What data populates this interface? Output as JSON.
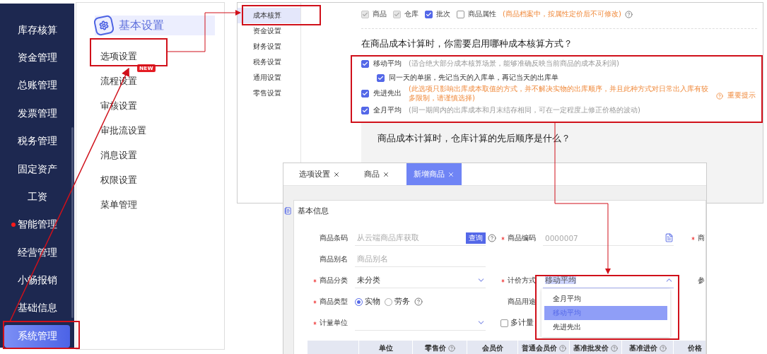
{
  "sidebar": {
    "items": [
      {
        "label": "库存核算",
        "selected": false,
        "alert": false
      },
      {
        "label": "资金管理",
        "selected": false,
        "alert": false
      },
      {
        "label": "总账管理",
        "selected": false,
        "alert": false
      },
      {
        "label": "发票管理",
        "selected": false,
        "alert": false
      },
      {
        "label": "税务管理",
        "selected": false,
        "alert": false
      },
      {
        "label": "固定资产",
        "selected": false,
        "alert": false
      },
      {
        "label": "工资",
        "selected": false,
        "alert": false
      },
      {
        "label": "智能管理",
        "selected": false,
        "alert": true
      },
      {
        "label": "经营管理",
        "selected": false,
        "alert": false
      },
      {
        "label": "小畅报销",
        "selected": false,
        "alert": false
      },
      {
        "label": "基础信息",
        "selected": false,
        "alert": false
      },
      {
        "label": "系统管理",
        "selected": true,
        "alert": false
      }
    ]
  },
  "settings_menu": {
    "title": "基本设置",
    "items": [
      {
        "label": "选项设置"
      },
      {
        "label": "流程设置",
        "badge": "NEW"
      },
      {
        "label": "审核设置"
      },
      {
        "label": "审批流设置"
      },
      {
        "label": "消息设置"
      },
      {
        "label": "权限设置"
      },
      {
        "label": "菜单管理"
      }
    ]
  },
  "cost_settings": {
    "menu": [
      {
        "label": "成本核算",
        "selected": true
      },
      {
        "label": "资金设置",
        "selected": false
      },
      {
        "label": "财务设置",
        "selected": false
      },
      {
        "label": "税务设置",
        "selected": false
      },
      {
        "label": "通用设置",
        "selected": false
      },
      {
        "label": "零售设置",
        "selected": false
      }
    ],
    "factors": [
      {
        "label": "商品",
        "checked": true,
        "disabled": true
      },
      {
        "label": "仓库",
        "checked": true,
        "disabled": true
      },
      {
        "label": "批次",
        "checked": true,
        "disabled": false
      },
      {
        "label": "商品属性",
        "checked": false,
        "disabled": false
      }
    ],
    "factors_note": "(商品档案中，按属性定价后不可修改)",
    "question": "在商品成本计算时，你需要启用哪种成本核算方式？",
    "methods": [
      {
        "label": "移动平均",
        "checked": true,
        "warning": false,
        "note": "(适合绝大部分成本核算场景，能够准确反映当前商品的成本及利润)",
        "children": [
          {
            "label": "同一天的单据，先记当天的入库单，再记当天的出库单",
            "checked": true
          }
        ]
      },
      {
        "label": "先进先出",
        "checked": true,
        "warning": true,
        "note": "(此选项只影响出库成本取值的方式，并不解决实物的出库顺序，并且此种方式对日常出入库有较多限制，请谨慎选择)",
        "link": "重要提示"
      },
      {
        "label": "全月平均",
        "checked": true,
        "warning": false,
        "note": "(同一期间内的出库成本和月末结存相同，可在一定程度上修正价格的波动)"
      }
    ],
    "next_question": "商品成本计算时，仓库计算的先后顺序是什么？"
  },
  "product_form": {
    "tabs": [
      {
        "label": "选项设置",
        "selected": false
      },
      {
        "label": "商品",
        "selected": false
      },
      {
        "label": "新增商品",
        "selected": true
      }
    ],
    "section_title": "基本信息",
    "rows": [
      [
        {
          "kind": "text",
          "label": "商品条码",
          "required": false,
          "placeholder": "从云端商品库获取",
          "button": "查询",
          "help": true
        },
        {
          "kind": "code",
          "label": "商品编码",
          "required": true,
          "placeholder": "0000007"
        },
        {
          "kind": "cut",
          "label": "商",
          "required": true
        }
      ],
      [
        {
          "kind": "text",
          "label": "商品别名",
          "required": false,
          "placeholder": "商品别名"
        }
      ],
      [
        {
          "kind": "select",
          "label": "商品分类",
          "required": true,
          "value": "未分类",
          "expanded": false
        },
        {
          "kind": "select",
          "label": "计价方式",
          "required": true,
          "value": "移动平均",
          "expanded": true,
          "options": [
            {
              "label": "全月平均",
              "selected": false
            },
            {
              "label": "移动平均",
              "selected": true
            },
            {
              "label": "先进先出",
              "selected": false
            }
          ]
        },
        {
          "kind": "cut",
          "label": "参",
          "required": false
        }
      ],
      [
        {
          "kind": "radio",
          "label": "商品类型",
          "required": true,
          "help": true,
          "options": [
            {
              "label": "实物",
              "selected": true
            },
            {
              "label": "劳务",
              "selected": false
            }
          ]
        },
        {
          "kind": "plain",
          "label": "商品用途",
          "required": false
        }
      ],
      [
        {
          "kind": "select",
          "label": "计量单位",
          "required": true,
          "expanded": false
        },
        {
          "kind": "check",
          "label": "多计量",
          "checked": false
        }
      ]
    ],
    "table": {
      "columns": [
        {
          "label": "单位",
          "help": false
        },
        {
          "label": "零售价",
          "help": true
        },
        {
          "label": "会员价",
          "help": false
        },
        {
          "label": "普通会员价",
          "help": true
        },
        {
          "label": "基准批发价",
          "help": true
        },
        {
          "label": "基准进价",
          "help": true
        },
        {
          "label": "价格",
          "help": false
        }
      ]
    }
  }
}
